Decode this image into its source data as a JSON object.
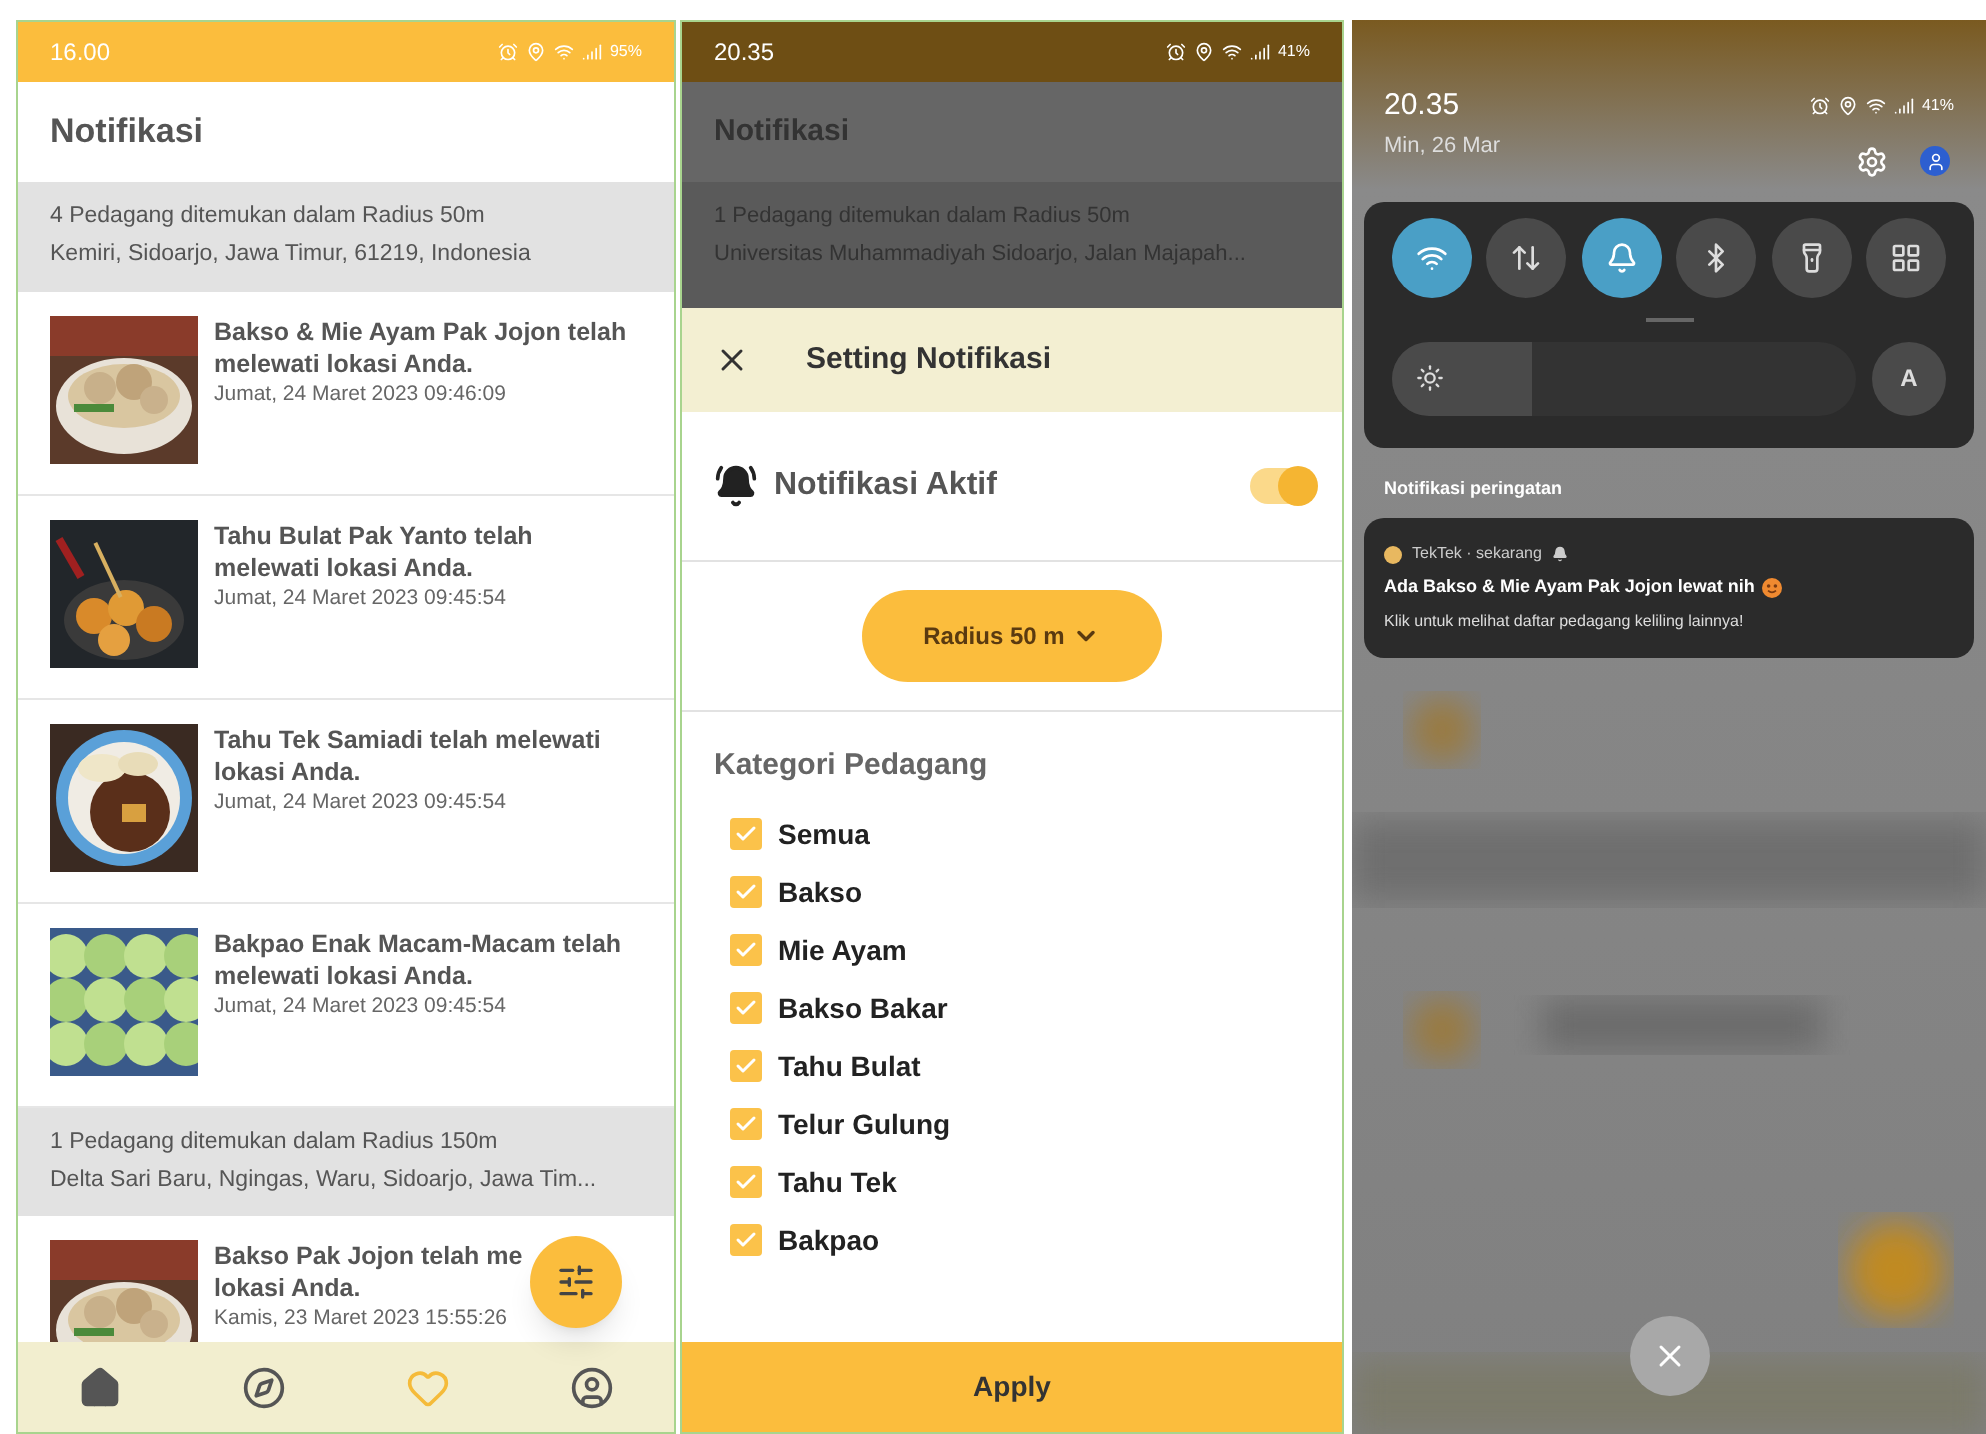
{
  "screens": [
    {
      "kind": "list",
      "status_bar": {
        "time": "16.00",
        "battery": "95%"
      },
      "title": "Notifikasi",
      "groups": [
        {
          "header": "4 Pedagang ditemukan dalam Radius 50m",
          "address": "Kemiri, Sidoarjo, Jawa Timur, 61219, Indonesia",
          "items": [
            {
              "title": "Bakso & Mie Ayam Pak Jojon telah melewati lokasi Anda.",
              "date": "Jumat, 24 Maret 2023 09:46:09"
            },
            {
              "title": "Tahu Bulat Pak Yanto telah melewati lokasi Anda.",
              "date": "Jumat, 24 Maret 2023 09:45:54"
            },
            {
              "title": "Tahu Tek Samiadi telah melewati lokasi Anda.",
              "date": "Jumat, 24 Maret 2023 09:45:54"
            },
            {
              "title": "Bakpao Enak Macam-Macam telah melewati lokasi Anda.",
              "date": "Jumat, 24 Maret 2023 09:45:54"
            }
          ]
        },
        {
          "header": "1 Pedagang ditemukan dalam Radius 150m",
          "address": "Delta Sari Baru, Ngingas, Waru, Sidoarjo, Jawa Tim...",
          "items": [
            {
              "title": "Bakso Pak Jojon telah me",
              "title_end": "lokasi Anda.",
              "date": "Kamis, 23 Maret 2023 15:55:26"
            }
          ]
        }
      ],
      "nav": [
        {
          "kind": "home",
          "selected": false
        },
        {
          "kind": "compass",
          "selected": false
        },
        {
          "kind": "heart",
          "selected": true
        },
        {
          "kind": "user",
          "selected": false
        }
      ]
    },
    {
      "kind": "settings",
      "status_bar": {
        "time": "20.35",
        "battery": "41%"
      },
      "background": {
        "title": "Notifikasi",
        "header": "1 Pedagang ditemukan dalam Radius 50m",
        "address": "Universitas Muhammadiyah Sidoarjo, Jalan Majapah..."
      },
      "sheet": {
        "title": "Setting Notifikasi",
        "toggle": {
          "label": "Notifikasi Aktif",
          "on": true
        },
        "radius": "Radius 50 m",
        "category_title": "Kategori Pedagang",
        "categories": [
          {
            "label": "Semua",
            "checked": true
          },
          {
            "label": "Bakso",
            "checked": true
          },
          {
            "label": "Mie Ayam",
            "checked": true
          },
          {
            "label": "Bakso Bakar",
            "checked": true
          },
          {
            "label": "Tahu Bulat",
            "checked": true
          },
          {
            "label": "Telur Gulung",
            "checked": true
          },
          {
            "label": "Tahu Tek",
            "checked": true
          },
          {
            "label": "Bakpao",
            "checked": true
          }
        ],
        "apply": "Apply"
      }
    },
    {
      "kind": "shade",
      "time": "20.35",
      "battery": "41%",
      "date": "Min, 26 Mar",
      "tiles": [
        {
          "kind": "wifi",
          "on": true
        },
        {
          "kind": "data",
          "on": false
        },
        {
          "kind": "bell",
          "on": true
        },
        {
          "kind": "bluetooth",
          "on": false
        },
        {
          "kind": "torch",
          "on": false
        },
        {
          "kind": "grid",
          "on": false
        }
      ],
      "brightness": {
        "level": 0.3,
        "auto": "A"
      },
      "section_title": "Notifikasi peringatan",
      "notification": {
        "source": "TekTek · sekarang",
        "title": "Ada Bakso & Mie Ayam Pak Jojon lewat nih",
        "body": "Klik untuk melihat daftar pedagang keliling lainnya!"
      }
    }
  ]
}
